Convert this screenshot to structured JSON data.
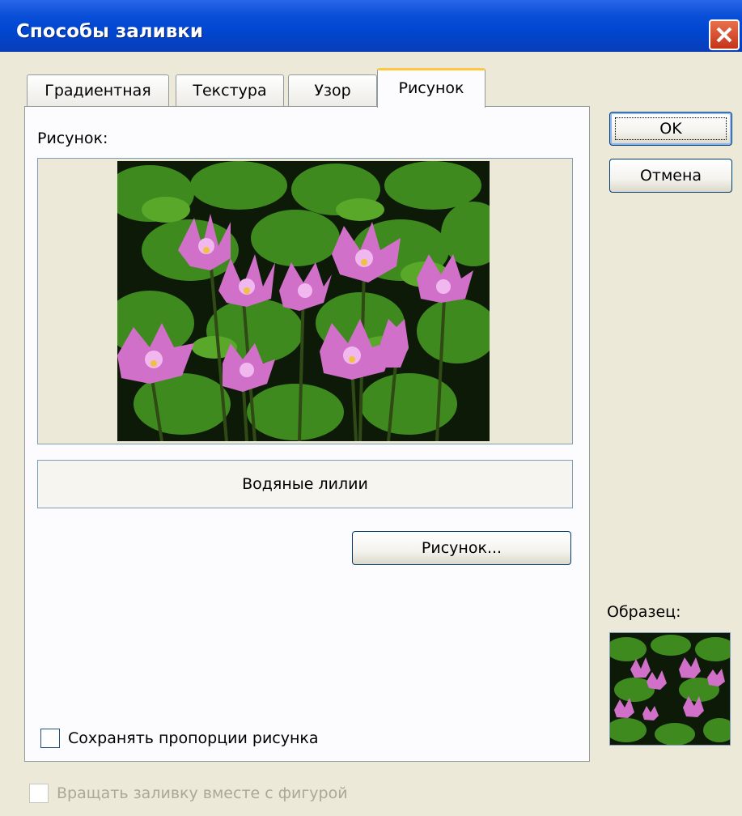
{
  "window": {
    "title": "Способы заливки"
  },
  "tabs": [
    {
      "label": "Градиентная"
    },
    {
      "label": "Текстура"
    },
    {
      "label": "Узор"
    },
    {
      "label": "Рисунок"
    }
  ],
  "picture_tab": {
    "picture_label": "Рисунок:",
    "picture_name": "Водяные лилии",
    "select_picture_button": "Рисунок...",
    "lock_aspect_checkbox": {
      "label": "Сохранять пропорции рисунка",
      "checked": false
    }
  },
  "buttons": {
    "ok": "OK",
    "cancel": "Отмена"
  },
  "sample": {
    "label": "Образец:"
  },
  "rotate_checkbox": {
    "label": "Вращать заливку вместе с фигурой",
    "checked": false,
    "enabled": false
  },
  "colors": {
    "title_bar": "#0a4fd8",
    "dialog_bg": "#ece9d8",
    "tab_highlight": "#ffc83c"
  }
}
